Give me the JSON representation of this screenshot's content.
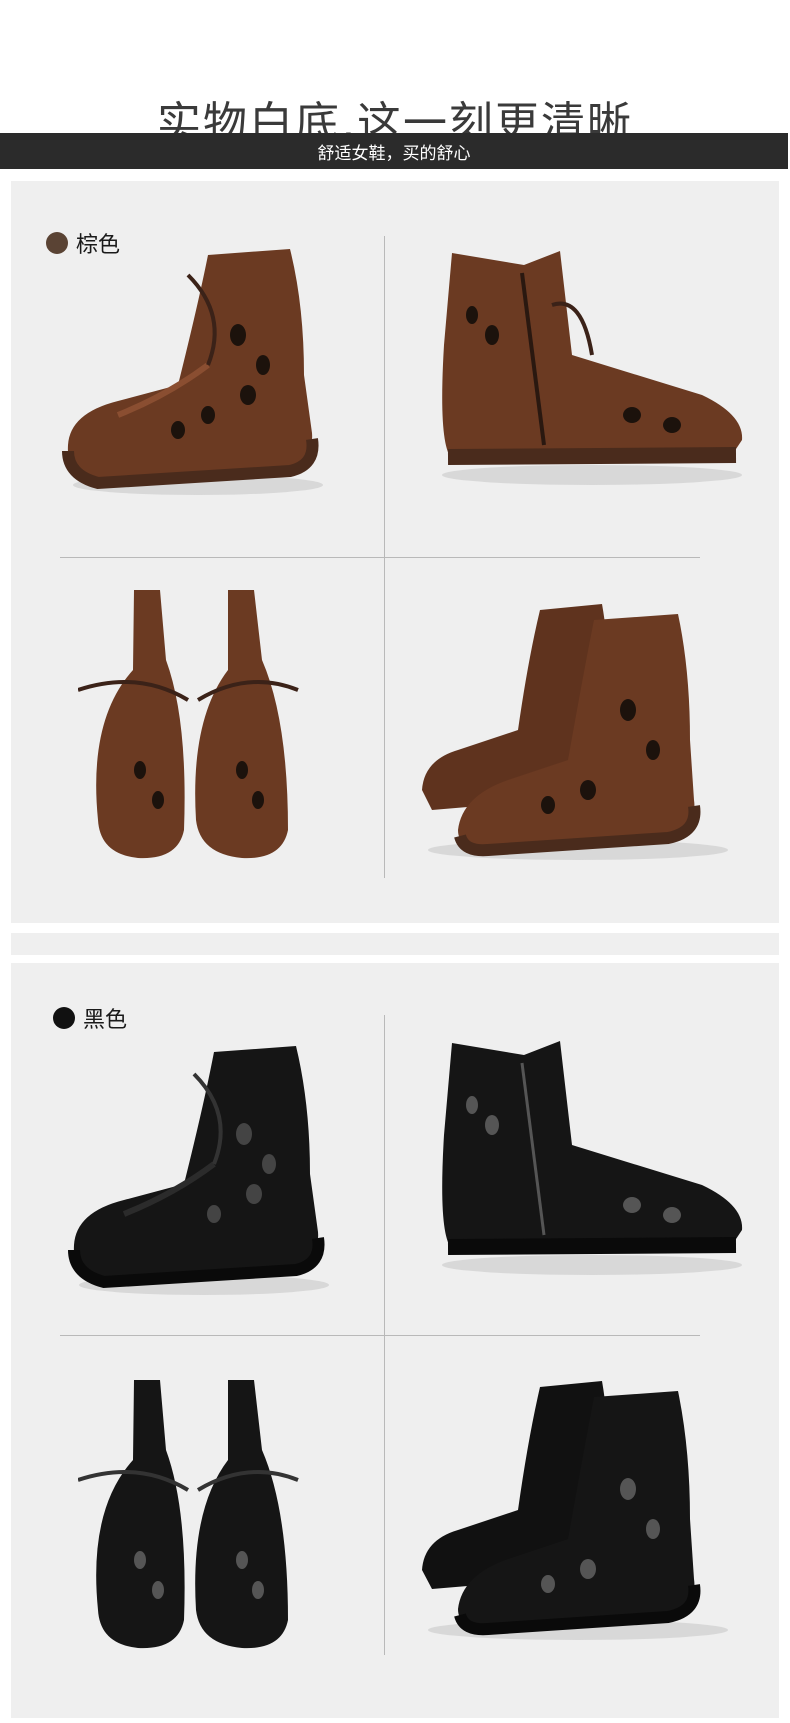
{
  "header": {
    "title": "实物白底,这一刻更清晰",
    "subtitle": "舒适女鞋，买的舒心"
  },
  "sections": [
    {
      "label": "棕色",
      "dot_color": "#5a4334",
      "leather": "#6b3a22",
      "leather_light": "#8a4e31",
      "sole": "#4a2b1c"
    },
    {
      "label": "黑色",
      "dot_color": "#111111",
      "leather": "#151515",
      "leather_light": "#2b2b2b",
      "sole": "#0c0c0c"
    }
  ]
}
